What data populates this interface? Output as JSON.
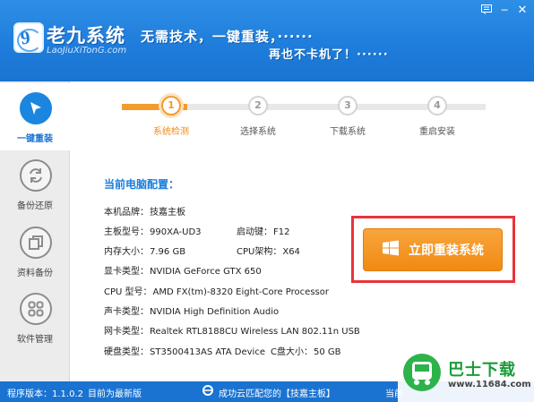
{
  "header": {
    "brand_name": "老九系统",
    "brand_url": "LaoJiuXiTonG.com",
    "slogan_line1": "无需技术，一键重装，······",
    "slogan_line2": "再也不卡机了！······",
    "controls": [
      "menu-icon",
      "minimize-icon",
      "close-icon"
    ]
  },
  "sidebar": {
    "items": [
      {
        "label": "一键重装",
        "icon": "cursor-arrow-icon",
        "active": true
      },
      {
        "label": "备份还原",
        "icon": "refresh-icon",
        "active": false
      },
      {
        "label": "资料备份",
        "icon": "copy-icon",
        "active": false
      },
      {
        "label": "软件管理",
        "icon": "grid-icon",
        "active": false
      }
    ]
  },
  "steps": {
    "items": [
      {
        "num": "1",
        "label": "系统检测"
      },
      {
        "num": "2",
        "label": "选择系统"
      },
      {
        "num": "3",
        "label": "下载系统"
      },
      {
        "num": "4",
        "label": "重启安装"
      }
    ],
    "current": 1,
    "progress_fraction": 0.18
  },
  "config": {
    "title": "当前电脑配置：",
    "brand": {
      "label": "本机品牌：",
      "value": "技嘉主板"
    },
    "board": {
      "label": "主板型号：",
      "value": "990XA-UD3"
    },
    "bootkey": {
      "label": "启动键：",
      "value": "F12"
    },
    "memory": {
      "label": "内存大小：",
      "value": "7.96 GB"
    },
    "cpu_arch": {
      "label": "CPU架构：",
      "value": "X64"
    },
    "gpu": {
      "label": "显卡类型：",
      "value": "NVIDIA GeForce GTX 650"
    },
    "cpu_model": {
      "label": "CPU 型号：",
      "value": "AMD FX(tm)-8320 Eight-Core Processor"
    },
    "sound": {
      "label": "声卡类型：",
      "value": "NVIDIA High Definition Audio"
    },
    "nic": {
      "label": "网卡类型：",
      "value": "Realtek RTL8188CU Wireless LAN 802.11n USB"
    },
    "disk": {
      "label": "硬盘类型：",
      "value": "ST3500413AS ATA Device"
    },
    "cdisk": {
      "label": "C盘大小：",
      "value": "50 GB"
    }
  },
  "install_button": {
    "label": "立即重装系统",
    "icon": "windows-icon"
  },
  "statusbar": {
    "version": "程序版本：1.1.0.2",
    "latest": "目前为最新版",
    "cloud": "成功云匹配您的【技嘉主板】",
    "right": "当前"
  },
  "watermark": {
    "name": "巴士下载",
    "url": "www.11684.com"
  },
  "colors": {
    "accent_blue": "#1a73d1",
    "orange": "#f08a13",
    "highlight_red": "#e8333a"
  }
}
